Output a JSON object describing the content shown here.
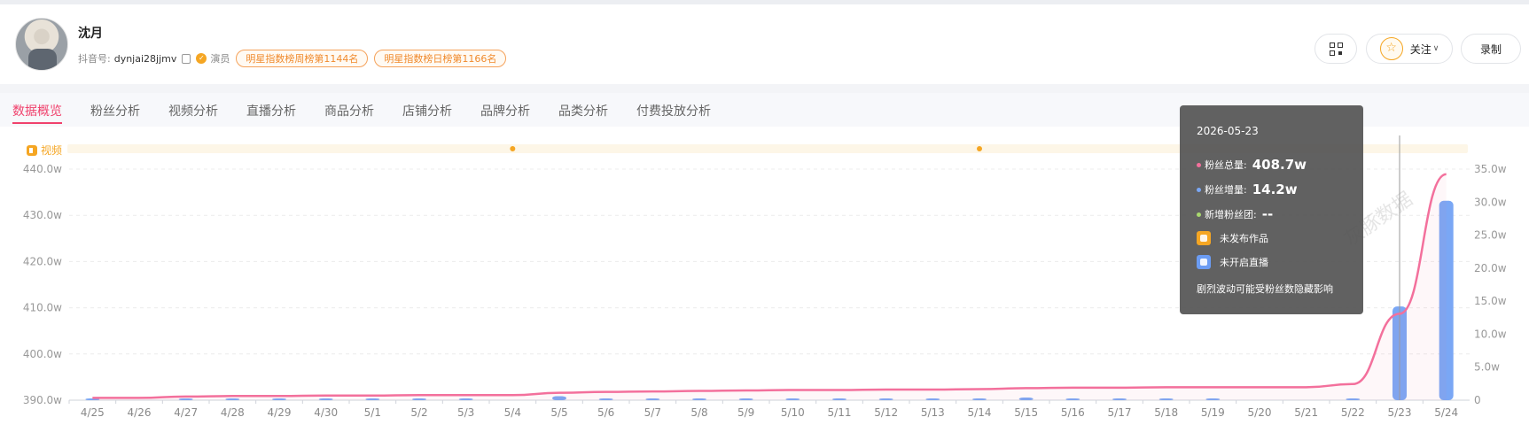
{
  "profile": {
    "name": "沈月",
    "douyin_label": "抖音号:",
    "douyin_id": "dynjai28jjmv",
    "role": "演员",
    "rank_weekly": "明星指数榜周榜第1144名",
    "rank_daily": "明星指数榜日榜第1166名",
    "follow_label": "关注",
    "record_label": "录制"
  },
  "tabs": [
    "数据概览",
    "粉丝分析",
    "视频分析",
    "直播分析",
    "商品分析",
    "店铺分析",
    "品牌分析",
    "品类分析",
    "付费投放分析"
  ],
  "video_band_label": "视频",
  "tooltip": {
    "date": "2026-05-23",
    "total_label": "粉丝总量:",
    "total_value": "408.7w",
    "inc_label": "粉丝增量:",
    "inc_value": "14.2w",
    "club_label": "新增粉丝团:",
    "club_value": "--",
    "no_video": "未发布作品",
    "no_live": "未开启直播",
    "note": "剧烈波动可能受粉丝数隐藏影响"
  },
  "watermark": "灰豚数据",
  "colors": {
    "line": "#f3709c",
    "bar": "#7aa7f5",
    "accent": "#f0416c",
    "video_dot": "#f5a623",
    "club_dot": "#a8d86e"
  },
  "chart_data": {
    "type": "bar+line",
    "x": [
      "4/25",
      "4/26",
      "4/27",
      "4/28",
      "4/29",
      "4/30",
      "5/1",
      "5/2",
      "5/3",
      "5/4",
      "5/5",
      "5/6",
      "5/7",
      "5/8",
      "5/9",
      "5/10",
      "5/11",
      "5/12",
      "5/13",
      "5/14",
      "5/15",
      "5/16",
      "5/17",
      "5/18",
      "5/19",
      "5/20",
      "5/21",
      "5/22",
      "5/23",
      "5/24"
    ],
    "series": [
      {
        "name": "粉丝总量",
        "type": "line",
        "axis": "left",
        "values": [
          390.5,
          390.5,
          390.8,
          390.9,
          390.9,
          391.0,
          391.0,
          391.1,
          391.1,
          391.1,
          391.6,
          391.8,
          391.9,
          392.0,
          392.1,
          392.2,
          392.2,
          392.3,
          392.3,
          392.4,
          392.6,
          392.7,
          392.7,
          392.8,
          392.8,
          392.8,
          392.8,
          393.5,
          408.7,
          438.9
        ]
      },
      {
        "name": "粉丝增量",
        "type": "bar",
        "axis": "right",
        "values": [
          0.1,
          0,
          0.2,
          0.05,
          0.05,
          0.05,
          0.05,
          0.05,
          0.05,
          0,
          0.6,
          0.2,
          0.1,
          0.1,
          0.1,
          0.05,
          0.05,
          0.05,
          0.05,
          0.1,
          0.4,
          0.1,
          0.1,
          0.05,
          0.05,
          0,
          0,
          0.1,
          14.2,
          30.2
        ]
      }
    ],
    "video_markers": [
      "5/4",
      "5/14"
    ],
    "y_left": {
      "ticks": [
        "390.0w",
        "400.0w",
        "410.0w",
        "420.0w",
        "430.0w",
        "440.0w"
      ],
      "range": [
        390,
        440
      ]
    },
    "y_right": {
      "ticks": [
        "0",
        "5.0w",
        "10.0w",
        "15.0w",
        "20.0w",
        "25.0w",
        "30.0w",
        "35.0w"
      ],
      "range": [
        0,
        35
      ]
    },
    "grid": true,
    "highlight": "5/23"
  }
}
